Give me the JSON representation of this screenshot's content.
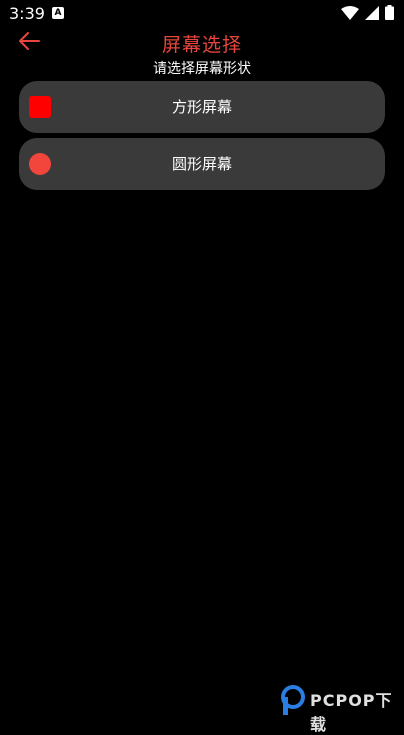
{
  "status_bar": {
    "time": "3:39",
    "notification_icon": "A",
    "icons": [
      "wifi-icon",
      "signal-icon",
      "battery-icon"
    ]
  },
  "app_bar": {
    "title": "屏幕选择",
    "subtitle": "请选择屏幕形状",
    "back_icon": "arrow-left-icon",
    "title_color": "#e8453c"
  },
  "options": [
    {
      "label": "方形屏幕",
      "icon": "square-icon",
      "color": "#ff0000"
    },
    {
      "label": "圆形屏幕",
      "icon": "circle-icon",
      "color": "#f2463c"
    }
  ],
  "watermark": {
    "text": "PCPOP下载"
  }
}
